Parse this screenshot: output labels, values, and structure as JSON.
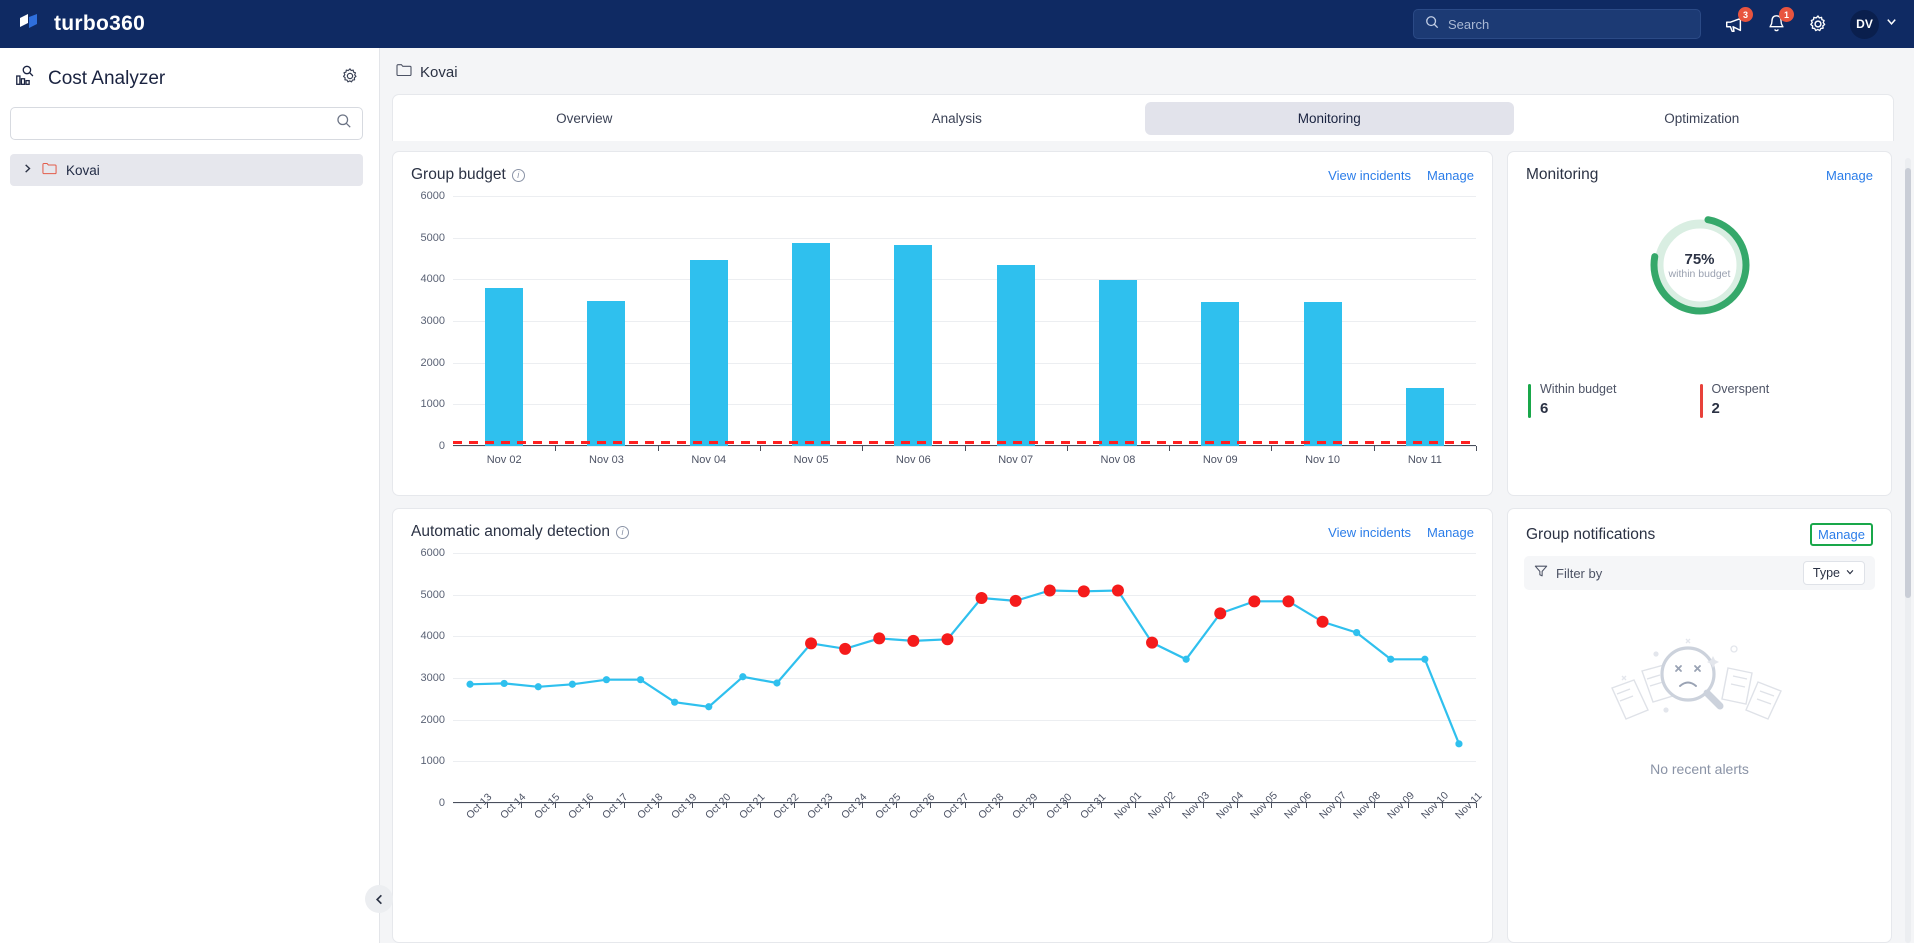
{
  "topbar": {
    "brand": "turbo360",
    "search_placeholder": "Search",
    "announcements_badge": "3",
    "notifications_badge": "1",
    "avatar_initials": "DV"
  },
  "sidebar": {
    "title": "Cost Analyzer",
    "search_placeholder": "",
    "search_value": "",
    "tree": [
      {
        "label": "Kovai"
      }
    ]
  },
  "breadcrumb": {
    "label": "Kovai"
  },
  "tabs": [
    {
      "label": "Overview",
      "active": false
    },
    {
      "label": "Analysis",
      "active": false
    },
    {
      "label": "Monitoring",
      "active": true
    },
    {
      "label": "Optimization",
      "active": false
    }
  ],
  "group_budget": {
    "title": "Group budget",
    "view_incidents": "View incidents",
    "manage": "Manage"
  },
  "anomaly": {
    "title": "Automatic anomaly detection",
    "view_incidents": "View incidents",
    "manage": "Manage"
  },
  "monitoring": {
    "title": "Monitoring",
    "manage": "Manage",
    "percent": "75%",
    "percent_sub": "within budget",
    "legend": [
      {
        "label": "Within budget",
        "value": "6",
        "color": "#19a74a"
      },
      {
        "label": "Overspent",
        "value": "2",
        "color": "#e8413a"
      }
    ]
  },
  "notifications": {
    "title": "Group notifications",
    "manage": "Manage",
    "filter_label": "Filter by",
    "type_label": "Type",
    "empty_text": "No recent alerts"
  },
  "colors": {
    "brand_navy": "#0f2a63",
    "bar_blue": "#2fc0ee",
    "budget_red": "#ff2020",
    "anomaly_red": "#f51b1b",
    "green": "#19a74a",
    "link_blue": "#2b7de9"
  },
  "chart_data": [
    {
      "type": "bar",
      "title": "Group budget",
      "categories": [
        "Nov 02",
        "Nov 03",
        "Nov 04",
        "Nov 05",
        "Nov 06",
        "Nov 07",
        "Nov 08",
        "Nov 09",
        "Nov 10",
        "Nov 11"
      ],
      "values": [
        3800,
        3480,
        4460,
        4880,
        4830,
        4350,
        3980,
        3450,
        3450,
        1400
      ],
      "budget_threshold": 60,
      "xlabel": "",
      "ylabel": "",
      "ylim": [
        0,
        6000
      ],
      "yticks": [
        0,
        1000,
        2000,
        3000,
        4000,
        5000,
        6000
      ],
      "grid": true,
      "legend": "none",
      "series_color": "#2fc0ee",
      "threshold_line_color": "#ff2020",
      "threshold_line_style": "dashed"
    },
    {
      "type": "line",
      "title": "Automatic anomaly detection",
      "x": [
        "Oct 13",
        "Oct 14",
        "Oct 15",
        "Oct 16",
        "Oct 17",
        "Oct 18",
        "Oct 19",
        "Oct 20",
        "Oct 21",
        "Oct 22",
        "Oct 23",
        "Oct 24",
        "Oct 25",
        "Oct 26",
        "Oct 27",
        "Oct 28",
        "Oct 29",
        "Oct 30",
        "Oct 31",
        "Nov 01",
        "Nov 02",
        "Nov 03",
        "Nov 04",
        "Nov 05",
        "Nov 06",
        "Nov 07",
        "Nov 08",
        "Nov 09",
        "Nov 10",
        "Nov 11"
      ],
      "values": [
        2850,
        2870,
        2790,
        2850,
        2960,
        2960,
        2420,
        2310,
        3030,
        2880,
        3830,
        3700,
        3950,
        3890,
        3930,
        4920,
        4850,
        5100,
        5080,
        5100,
        3850,
        3450,
        4550,
        4840,
        4840,
        4350,
        4090,
        3450,
        3450,
        1420
      ],
      "anomalies": [
        "Oct 23",
        "Oct 24",
        "Oct 25",
        "Oct 26",
        "Oct 27",
        "Oct 28",
        "Oct 29",
        "Oct 30",
        "Oct 31",
        "Nov 01",
        "Nov 02",
        "Nov 04",
        "Nov 05",
        "Nov 06",
        "Nov 07"
      ],
      "xlabel": "",
      "ylabel": "",
      "ylim": [
        0,
        6000
      ],
      "yticks": [
        0,
        1000,
        2000,
        3000,
        4000,
        5000,
        6000
      ],
      "grid": true,
      "legend": "none",
      "series_color": "#2fc0ee",
      "anomaly_color": "#f51b1b"
    }
  ]
}
